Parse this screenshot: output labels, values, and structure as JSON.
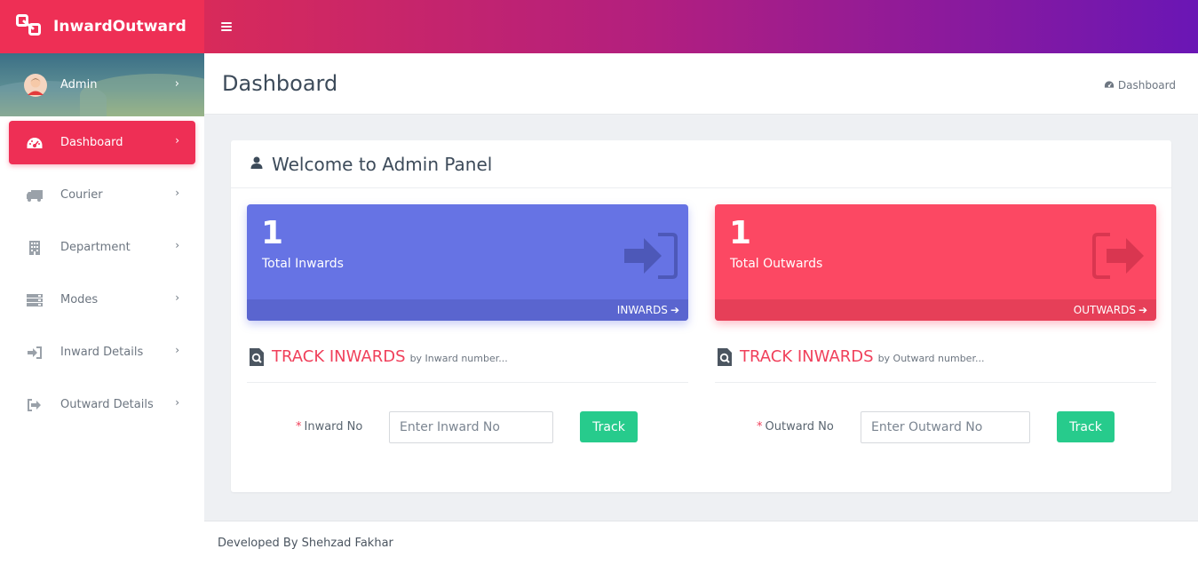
{
  "brand": {
    "title": "InwardOutward",
    "logo_icon": "link-squares-icon"
  },
  "topbar": {
    "menu_icon": "hamburger-icon"
  },
  "sidebar": {
    "user": {
      "name": "Admin"
    },
    "items": [
      {
        "label": "Dashboard",
        "icon": "dashboard-gauge-icon",
        "active": true
      },
      {
        "label": "Courier",
        "icon": "truck-icon"
      },
      {
        "label": "Department",
        "icon": "building-icon"
      },
      {
        "label": "Modes",
        "icon": "server-icon"
      },
      {
        "label": "Inward Details",
        "icon": "sign-in-icon"
      },
      {
        "label": "Outward Details",
        "icon": "sign-out-icon"
      }
    ]
  },
  "header": {
    "title": "Dashboard",
    "breadcrumb": "Dashboard"
  },
  "panel": {
    "title": "Welcome to Admin Panel",
    "inward_card": {
      "count": "1",
      "label": "Total Inwards",
      "link": "INWARDS",
      "color": "#6673e4"
    },
    "outward_card": {
      "count": "1",
      "label": "Total Outwards",
      "link": "OUTWARDS",
      "color": "#fc4863"
    },
    "track_inward": {
      "title": "TRACK INWARDS",
      "subtitle": "by Inward number...",
      "field_label": "Inward No",
      "placeholder": "Enter Inward No",
      "button": "Track"
    },
    "track_outward": {
      "title": "TRACK INWARDS",
      "subtitle": "by Outward number...",
      "field_label": "Outward No",
      "placeholder": "Enter Outward No",
      "button": "Track"
    }
  },
  "footer": {
    "text": "Developed By Shehzad Fakhar"
  },
  "colors": {
    "accent": "#ee2f55",
    "success": "#27cb8c"
  }
}
